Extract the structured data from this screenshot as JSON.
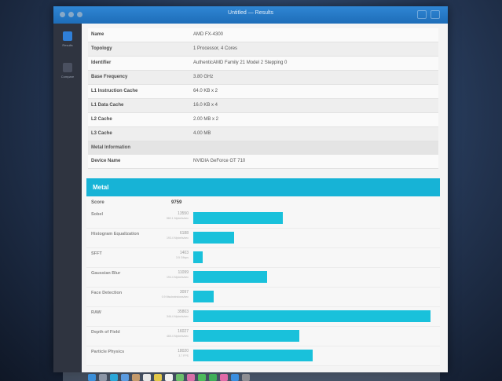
{
  "window": {
    "title": "Untitled — Results"
  },
  "sidebar": {
    "items": [
      {
        "label": "Results",
        "icon": "results-icon",
        "color": "#2f7fd8"
      },
      {
        "label": "Compare",
        "icon": "compare-icon",
        "color": "#4a5060"
      }
    ]
  },
  "info": {
    "rows": [
      {
        "key": "Name",
        "value": "AMD FX-4300"
      },
      {
        "key": "Topology",
        "value": "1 Processor, 4 Cores"
      },
      {
        "key": "Identifier",
        "value": "AuthenticAMD Family 21 Model 2 Stepping 0"
      },
      {
        "key": "Base Frequency",
        "value": "3.80 GHz"
      },
      {
        "key": "L1 Instruction Cache",
        "value": "64.0 KB x 2"
      },
      {
        "key": "L1 Data Cache",
        "value": "16.0 KB x 4"
      },
      {
        "key": "L2 Cache",
        "value": "2.00 MB x 2"
      },
      {
        "key": "L3 Cache",
        "value": "4.00 MB"
      }
    ],
    "metal_section": "Metal Information",
    "device": {
      "key": "Device Name",
      "value": "NVIDIA GeForce GT 710"
    }
  },
  "metal": {
    "header": "Metal",
    "score_label": "Score",
    "score_value": "9759",
    "max_score": 36000,
    "benchmarks": [
      {
        "name": "Sobel",
        "score": "13550",
        "rate": "582.1 Mpixels/sec",
        "value": 13550
      },
      {
        "name": "Histogram Equalization",
        "score": "6188",
        "rate": "193.4 Mpixels/sec",
        "value": 6188
      },
      {
        "name": "SFFT",
        "score": "1403",
        "rate": "3.5 Gflops",
        "value": 1403
      },
      {
        "name": "Gaussian Blur",
        "score": "11099",
        "rate": "194.4 Mpixels/sec",
        "value": 11099
      },
      {
        "name": "Face Detection",
        "score": "3097",
        "rate": "0.9 Msubwindows/sec",
        "value": 3097
      },
      {
        "name": "RAW",
        "score": "35803",
        "rate": "346.4 Mpixels/sec",
        "value": 35803
      },
      {
        "name": "Depth of Field",
        "score": "16027",
        "rate": "465.4 Mpixels/sec",
        "value": 16027
      },
      {
        "name": "Particle Physics",
        "score": "18020",
        "rate": "3.7 FPS",
        "value": 18020
      }
    ],
    "bar_color": "#19c1db"
  }
}
